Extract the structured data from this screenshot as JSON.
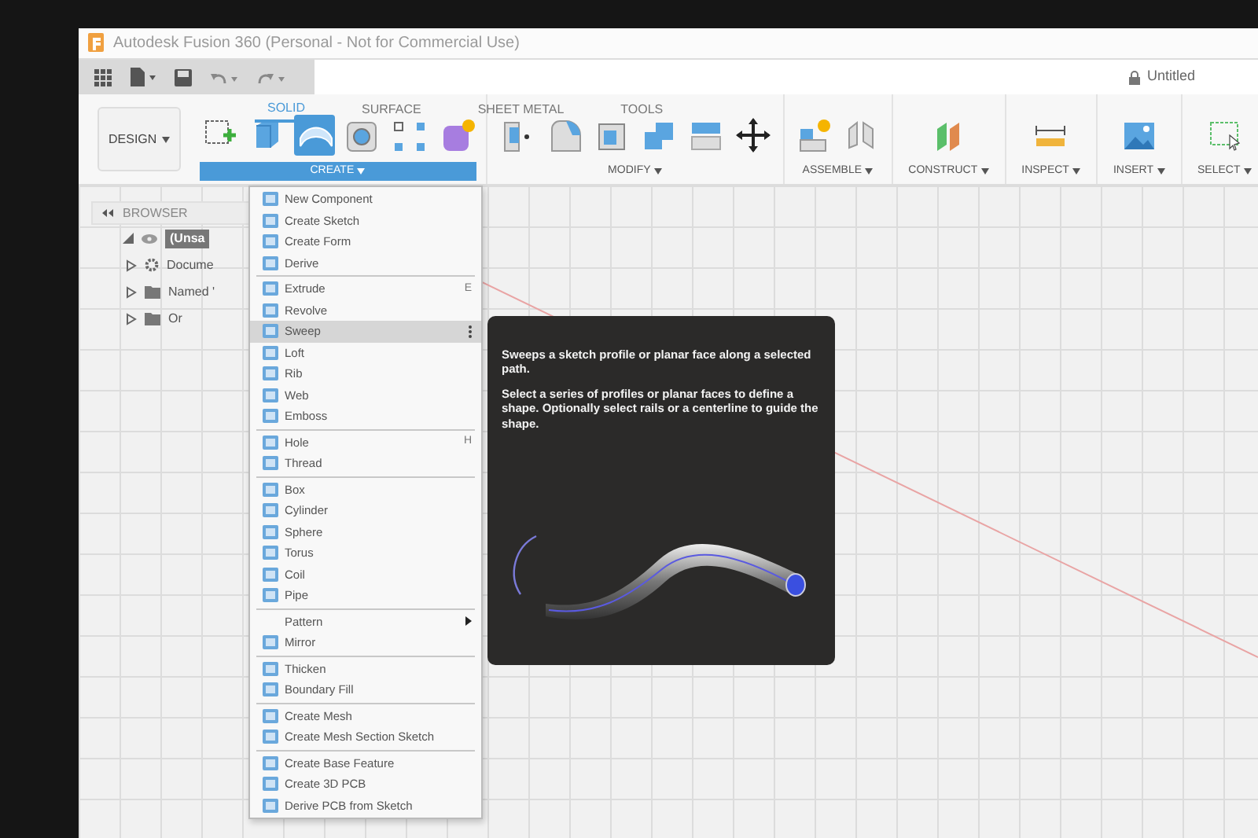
{
  "window": {
    "title": "Autodesk Fusion 360 (Personal - Not for Commercial Use)"
  },
  "document": {
    "name": "Untitled"
  },
  "workspace": {
    "label": "DESIGN"
  },
  "ribbon": {
    "tabs": [
      {
        "label": "SOLID",
        "selected": true
      },
      {
        "label": "SURFACE",
        "selected": false
      },
      {
        "label": "SHEET METAL",
        "selected": false
      },
      {
        "label": "TOOLS",
        "selected": false
      }
    ],
    "groups": [
      {
        "label": "CREATE",
        "selected": true,
        "tools": [
          {
            "selected": false
          },
          {
            "selected": false
          },
          {
            "selected": true
          },
          {
            "selected": false
          },
          {
            "selected": false
          },
          {
            "selected": false
          }
        ]
      },
      {
        "label": "MODIFY",
        "selected": false,
        "tools": [
          {
            "selected": false
          },
          {
            "selected": false
          },
          {
            "selected": false
          },
          {
            "selected": false
          },
          {
            "selected": false
          },
          {
            "selected": false
          }
        ]
      },
      {
        "label": "ASSEMBLE",
        "selected": false,
        "tools": [
          {
            "selected": false
          },
          {
            "selected": false
          }
        ]
      },
      {
        "label": "CONSTRUCT",
        "selected": false,
        "tools": [
          {
            "selected": false
          }
        ]
      },
      {
        "label": "INSPECT",
        "selected": false,
        "tools": [
          {
            "selected": false
          }
        ]
      },
      {
        "label": "INSERT",
        "selected": false,
        "tools": [
          {
            "selected": false
          }
        ]
      },
      {
        "label": "SELECT",
        "selected": false,
        "tools": [
          {
            "selected": false
          }
        ]
      }
    ]
  },
  "browser": {
    "title": "BROWSER",
    "tree": [
      {
        "label": "(Unsa",
        "expanded": true,
        "selected": true,
        "children": [
          {
            "label": "Docume",
            "expanded": false,
            "selected": false
          },
          {
            "label": "Named '",
            "expanded": false,
            "selected": false
          },
          {
            "label": "Or",
            "expanded": false,
            "selected": false
          }
        ]
      }
    ]
  },
  "create_menu": {
    "groups": [
      [
        {
          "label": "New Component",
          "kind": "item",
          "selected": false
        },
        {
          "label": "Create Sketch",
          "kind": "item",
          "selected": false
        },
        {
          "label": "Create Form",
          "kind": "item",
          "selected": false
        },
        {
          "label": "Derive",
          "kind": "item",
          "selected": false
        }
      ],
      [
        {
          "label": "Extrude",
          "kind": "item",
          "selected": false,
          "shortcut": "E"
        },
        {
          "label": "Revolve",
          "kind": "item",
          "selected": false
        },
        {
          "label": "Sweep",
          "kind": "item",
          "selected": true
        },
        {
          "label": "Loft",
          "kind": "item",
          "selected": false
        },
        {
          "label": "Rib",
          "kind": "item",
          "selected": false
        },
        {
          "label": "Web",
          "kind": "item",
          "selected": false
        },
        {
          "label": "Emboss",
          "kind": "item",
          "selected": false
        }
      ],
      [
        {
          "label": "Hole",
          "kind": "item",
          "selected": false,
          "shortcut": "H"
        },
        {
          "label": "Thread",
          "kind": "item",
          "selected": false
        }
      ],
      [
        {
          "label": "Box",
          "kind": "item",
          "selected": false
        },
        {
          "label": "Cylinder",
          "kind": "item",
          "selected": false
        },
        {
          "label": "Sphere",
          "kind": "item",
          "selected": false
        },
        {
          "label": "Torus",
          "kind": "item",
          "selected": false
        },
        {
          "label": "Coil",
          "kind": "item",
          "selected": false
        },
        {
          "label": "Pipe",
          "kind": "item",
          "selected": false
        }
      ],
      [
        {
          "label": "Pattern",
          "kind": "submenu",
          "selected": false
        },
        {
          "label": "Mirror",
          "kind": "item",
          "selected": false
        }
      ],
      [
        {
          "label": "Thicken",
          "kind": "item",
          "selected": false
        },
        {
          "label": "Boundary Fill",
          "kind": "item",
          "selected": false
        }
      ],
      [
        {
          "label": "Create Mesh",
          "kind": "item",
          "selected": false
        },
        {
          "label": "Create Mesh Section Sketch",
          "kind": "item",
          "selected": false
        }
      ],
      [
        {
          "label": "Create Base Feature",
          "kind": "item",
          "selected": false
        },
        {
          "label": "Create 3D PCB",
          "kind": "item",
          "selected": false
        },
        {
          "label": "Derive PCB from Sketch",
          "kind": "item",
          "selected": false
        }
      ]
    ]
  },
  "tooltip": {
    "paragraphs": [
      "Sweeps a sketch profile or planar face along a selected path.",
      "Select a series of profiles or planar faces to define a shape. Optionally select rails or a centerline to guide the shape."
    ]
  }
}
